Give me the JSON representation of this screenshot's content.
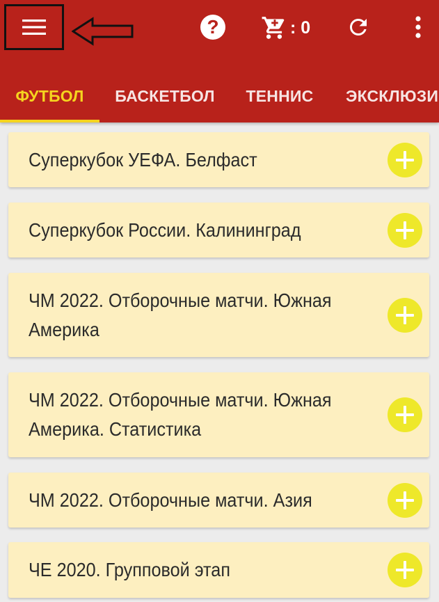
{
  "header": {
    "menu_icon": "hamburger-menu-icon",
    "pointer_icon": "left-arrow-icon",
    "help_icon": "question-icon",
    "help_symbol": "?",
    "cart_icon": "cart-icon",
    "cart_count": ": 0",
    "refresh_icon": "refresh-icon",
    "more_icon": "more-vertical-icon",
    "colors": {
      "bar": "#b8221b",
      "accent": "#f5d41f"
    }
  },
  "tabs": [
    {
      "label": "ФУТБОЛ",
      "active": true
    },
    {
      "label": "БАСКЕТБОЛ",
      "active": false
    },
    {
      "label": "ТЕННИС",
      "active": false
    },
    {
      "label": "ЭКСКЛЮЗИ",
      "active": false
    }
  ],
  "events": [
    {
      "title": "Суперкубок УЕФА. Белфаст"
    },
    {
      "title": "Суперкубок России. Калининград"
    },
    {
      "title": "ЧМ 2022. Отборочные матчи. Южная Америка"
    },
    {
      "title": "ЧМ 2022. Отборочные матчи. Южная Америка. Статистика"
    },
    {
      "title": "ЧМ 2022. Отборочные матчи. Азия"
    },
    {
      "title": "ЧЕ 2020. Групповой этап"
    }
  ],
  "colors": {
    "card_background": "#fdefc0",
    "add_button": "#eee82a",
    "page_background": "#ececec"
  }
}
